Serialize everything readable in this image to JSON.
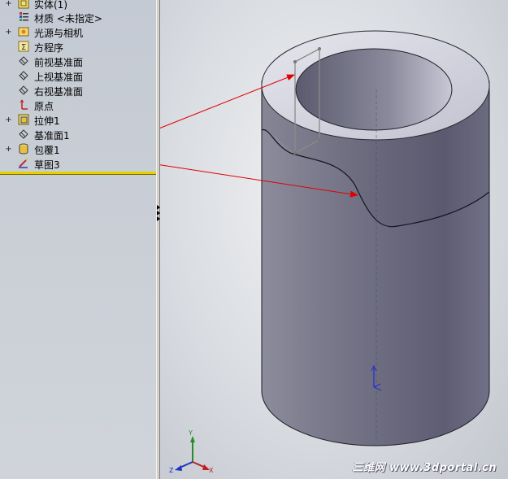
{
  "feature_tree": {
    "items": [
      {
        "label": "实体(1)",
        "expandable": true,
        "icon": "solid-bodies-icon"
      },
      {
        "label": "材质 <未指定>",
        "expandable": false,
        "icon": "material-icon"
      },
      {
        "label": "光源与相机",
        "expandable": true,
        "icon": "lights-cameras-icon"
      },
      {
        "label": "方程序",
        "expandable": false,
        "icon": "equations-icon"
      },
      {
        "label": "前视基准面",
        "expandable": false,
        "icon": "plane-icon"
      },
      {
        "label": "上视基准面",
        "expandable": false,
        "icon": "plane-icon"
      },
      {
        "label": "右视基准面",
        "expandable": false,
        "icon": "plane-icon"
      },
      {
        "label": "原点",
        "expandable": false,
        "icon": "origin-icon"
      },
      {
        "label": "拉伸1",
        "expandable": true,
        "icon": "extrude-icon"
      },
      {
        "label": "基准面1",
        "expandable": false,
        "icon": "plane-icon"
      },
      {
        "label": "包覆1",
        "expandable": true,
        "icon": "wrap-icon"
      },
      {
        "label": "草图3",
        "expandable": false,
        "icon": "sketch-icon"
      }
    ],
    "expander_symbol": "+"
  },
  "triad": {
    "x": "X",
    "y": "Y",
    "z": "Z"
  },
  "watermark": "三维网 www.3dportal.cn",
  "colors": {
    "arrow": "#e00000",
    "rollback_bar": "#e6d000",
    "cylinder": "#6e6d80"
  }
}
